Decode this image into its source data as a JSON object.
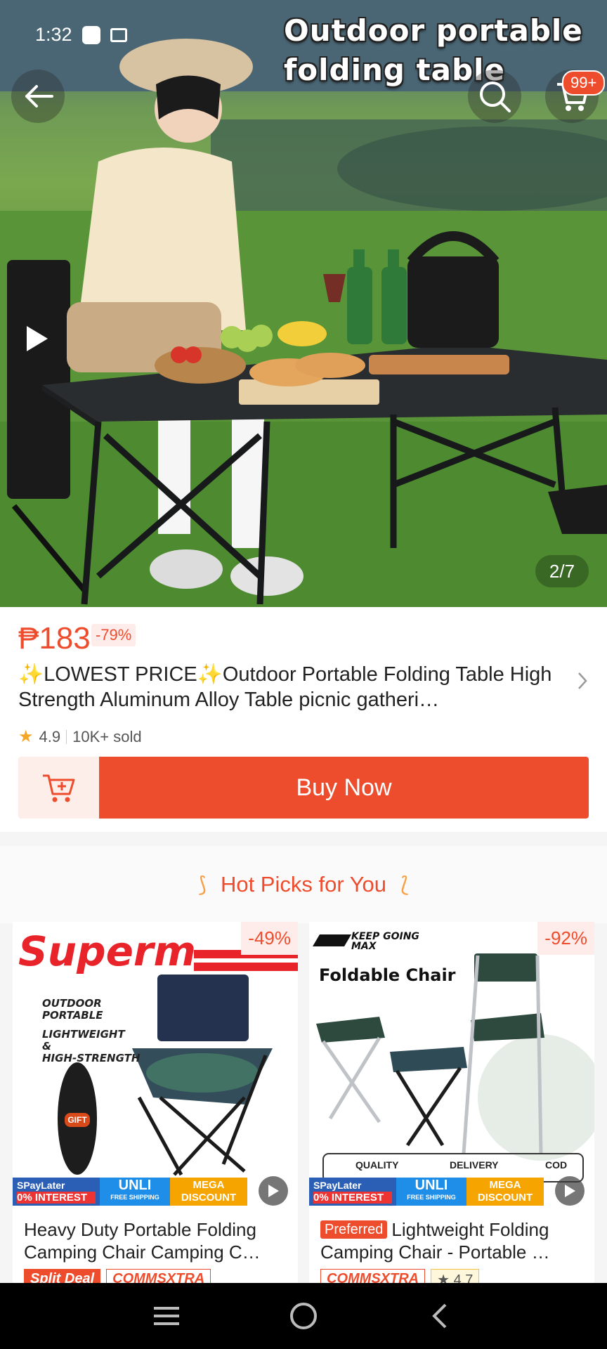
{
  "status_bar": {
    "time": "1:32"
  },
  "hero": {
    "banner_text": "Outdoor portable folding table",
    "cart_badge": "99+",
    "image_counter": "2/7"
  },
  "product": {
    "price": "₱183",
    "discount": "-79%",
    "title": "✨LOWEST PRICE✨Outdoor Portable Folding Table High Strength Aluminum Alloy Table picnic gatheri…",
    "rating": "4.9",
    "sold": "10K+ sold",
    "buy_now_label": "Buy Now"
  },
  "hot_picks": {
    "header": "Hot Picks for You",
    "cards": [
      {
        "discount": "-49%",
        "image_brand": "Superm",
        "image_lines": [
          "OUTDOOR",
          "PORTABLE",
          "LIGHTWEIGHT",
          "&",
          "HIGH-STRENGTH"
        ],
        "gift_label": "GIFT",
        "strip": {
          "spaylater": "SPayLater",
          "interest": "0% INTEREST",
          "unli": "UNLI",
          "free_shipping": "FREE SHIPPING",
          "mega": "MEGA",
          "discount_word": "DISCOUNT"
        },
        "title": "Heavy Duty Portable Folding Camping Chair Camping C…",
        "tags": [
          "Split Deal",
          "COMMSXTRA"
        ]
      },
      {
        "discount": "-92%",
        "image_brand": "KEEP GOING MAX",
        "image_heading": "Foldable Chair",
        "image_badges": [
          "QUALITY",
          "DELIVERY",
          "COD"
        ],
        "strip": {
          "spaylater": "SPayLater",
          "interest": "0% INTEREST",
          "unli": "UNLI",
          "free_shipping": "FREE SHIPPING",
          "mega": "MEGA",
          "discount_word": "DISCOUNT"
        },
        "preferred_label": "Preferred",
        "title": "Lightweight Folding Camping Chair - Portable …",
        "tags": [
          "COMMSXTRA",
          "4.7"
        ]
      }
    ]
  },
  "icons": [
    "back-arrow-icon",
    "search-icon",
    "cart-icon",
    "play-icon",
    "chevron-right-icon",
    "star-icon",
    "add-to-cart-icon",
    "menu-icon",
    "home-circle-icon",
    "nav-back-icon"
  ],
  "colors": {
    "accent": "#ee4d2d",
    "accent_light": "#fdeee9",
    "rating_star": "#f5a623"
  }
}
